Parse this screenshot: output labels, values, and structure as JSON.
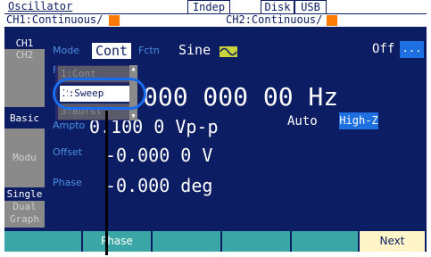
{
  "header": {
    "title": "Oscillator",
    "indep": "Indep",
    "disk": "Disk",
    "usb": "USB",
    "ch1_status": "CH1:Continuous/",
    "ch2_status": "CH2:Continuous/"
  },
  "left_tabs": {
    "ch1": "CH1",
    "ch2": "CH2",
    "basic": "Basic",
    "modu": "Modu",
    "single": "Single",
    "dual_line1": "Dual",
    "dual_line2": "Graph"
  },
  "mode": {
    "label": "Mode",
    "value": "Cont",
    "fctn_label": "Fctn",
    "fctn_value": "Sine",
    "output_state": "Off",
    "more_button": "..."
  },
  "params": {
    "freq_label": "Fr",
    "freq_value": "000 000 00 Hz",
    "ampl_label": "Ampto",
    "ampl_value": "0.100 0 Vp-p",
    "auto_label": "Auto",
    "load_value": "High-Z",
    "offset_label": "Offset",
    "offset_value": "-0.000 0 V",
    "phase_label": "Phase",
    "phase_value": "-0.000 deg"
  },
  "dropdown": {
    "items": [
      "1:Cont",
      "2:Sweep",
      "3:Burst"
    ],
    "selected_index": 1
  },
  "softkeys": [
    "",
    "Phase",
    "",
    "",
    "",
    "Next"
  ],
  "colors": {
    "screen_bg": "#0c1d63",
    "label_blue": "#4a90e0",
    "accent_blue": "#1e6fe0",
    "softkey_teal": "#3aa6a6",
    "next_key": "#fff5c9",
    "orange": "#ff7a00"
  },
  "icons": {
    "wave": "sine-wave-icon"
  }
}
